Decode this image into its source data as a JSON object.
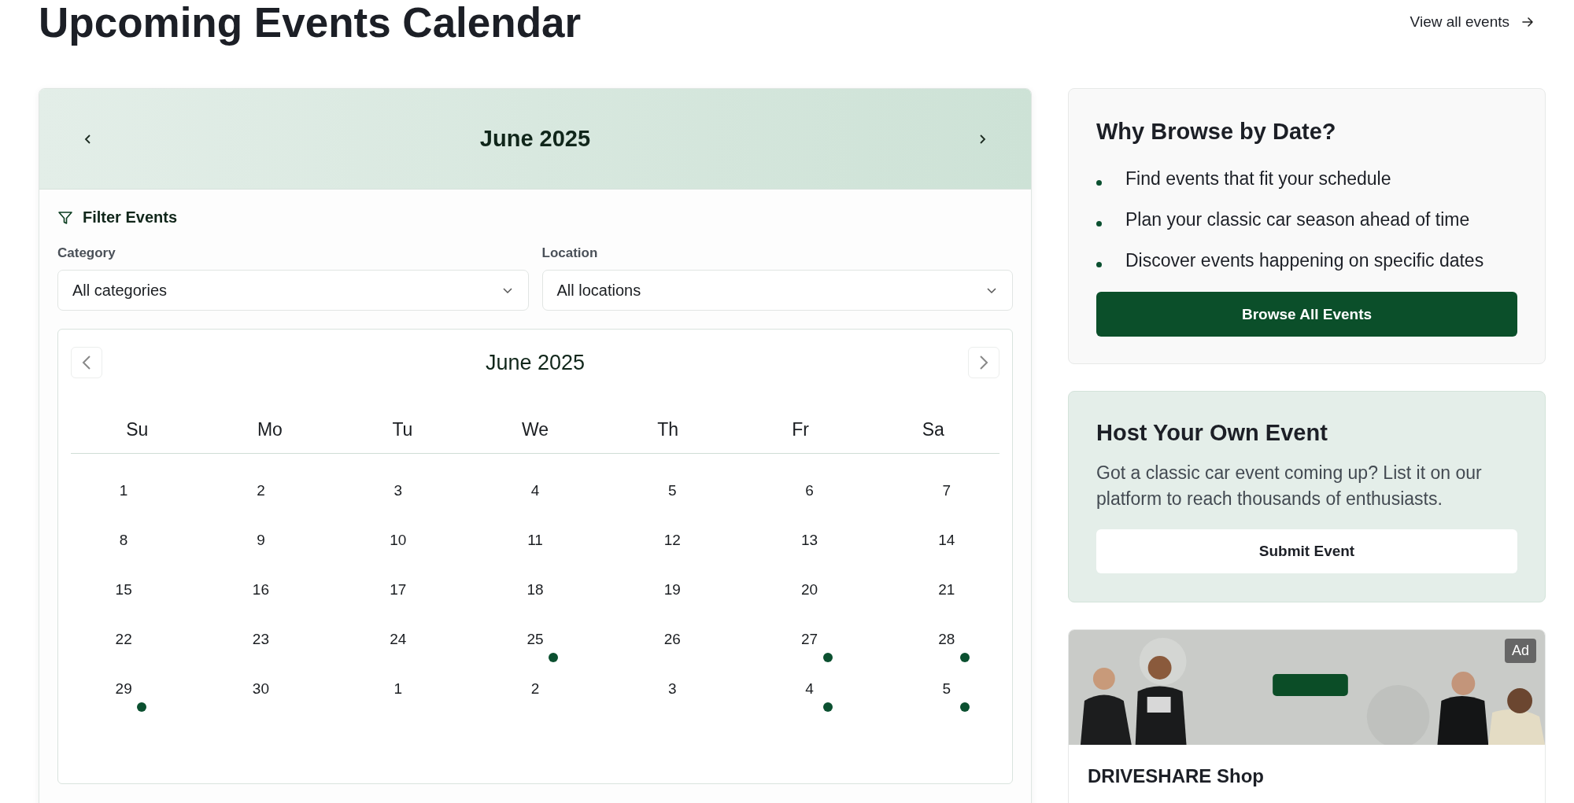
{
  "page_title": "Upcoming Events Calendar",
  "view_all_link": "View all events",
  "calendar_card": {
    "month_label": "June 2025",
    "filter": {
      "title": "Filter Events",
      "fields": [
        {
          "label": "Category",
          "value": "All categories"
        },
        {
          "label": "Location",
          "value": "All locations"
        }
      ]
    },
    "calendar": {
      "month_label": "June 2025",
      "weekdays": [
        "Su",
        "Mo",
        "Tu",
        "We",
        "Th",
        "Fr",
        "Sa"
      ],
      "days": [
        {
          "day": "1",
          "has_event": false
        },
        {
          "day": "2",
          "has_event": false
        },
        {
          "day": "3",
          "has_event": false
        },
        {
          "day": "4",
          "has_event": false
        },
        {
          "day": "5",
          "has_event": false
        },
        {
          "day": "6",
          "has_event": false
        },
        {
          "day": "7",
          "has_event": false
        },
        {
          "day": "8",
          "has_event": false
        },
        {
          "day": "9",
          "has_event": false
        },
        {
          "day": "10",
          "has_event": false
        },
        {
          "day": "11",
          "has_event": false
        },
        {
          "day": "12",
          "has_event": false
        },
        {
          "day": "13",
          "has_event": false
        },
        {
          "day": "14",
          "has_event": false
        },
        {
          "day": "15",
          "has_event": false
        },
        {
          "day": "16",
          "has_event": false
        },
        {
          "day": "17",
          "has_event": false
        },
        {
          "day": "18",
          "has_event": false
        },
        {
          "day": "19",
          "has_event": false
        },
        {
          "day": "20",
          "has_event": false
        },
        {
          "day": "21",
          "has_event": false
        },
        {
          "day": "22",
          "has_event": false
        },
        {
          "day": "23",
          "has_event": false
        },
        {
          "day": "24",
          "has_event": false
        },
        {
          "day": "25",
          "has_event": true
        },
        {
          "day": "26",
          "has_event": false
        },
        {
          "day": "27",
          "has_event": true
        },
        {
          "day": "28",
          "has_event": true
        },
        {
          "day": "29",
          "has_event": true
        },
        {
          "day": "30",
          "has_event": false
        },
        {
          "day": "1",
          "has_event": false
        },
        {
          "day": "2",
          "has_event": false
        },
        {
          "day": "3",
          "has_event": false
        },
        {
          "day": "4",
          "has_event": true
        },
        {
          "day": "5",
          "has_event": true
        }
      ]
    }
  },
  "why_card": {
    "title": "Why Browse by Date?",
    "points": [
      "Find events that fit your schedule",
      "Plan your classic car season ahead of time",
      "Discover events happening on specific dates"
    ],
    "button": "Browse All Events"
  },
  "host_card": {
    "title": "Host Your Own Event",
    "text": "Got a classic car event coming up? List it on our platform to reach thousands of enthusiasts.",
    "button": "Submit Event"
  },
  "ad_card": {
    "badge": "Ad",
    "title": "DRIVESHARE Shop"
  }
}
